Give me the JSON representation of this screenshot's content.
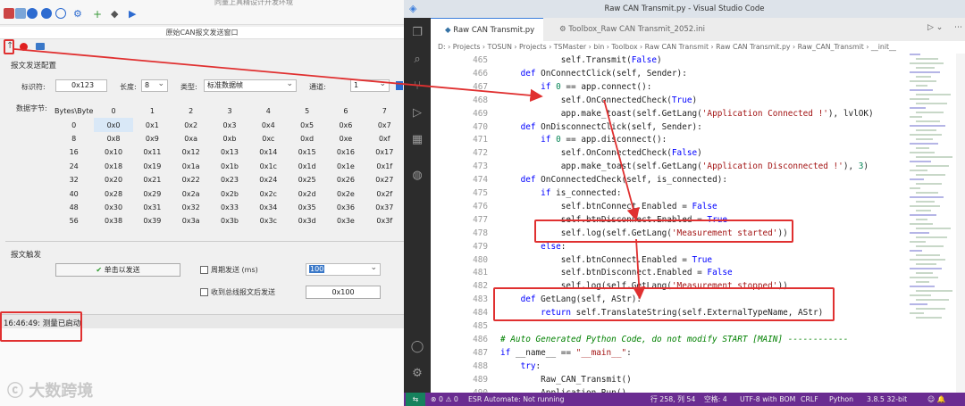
{
  "left_app": {
    "topbar_title_cut": "同量上具精设计开发环境",
    "window_title": "原始CAN报文发送窗口",
    "section_send_config": "报文发送配置",
    "id_label": "标识符:",
    "id_value": "0x123",
    "length_label": "长度:",
    "length_value": "8",
    "type_label": "类型:",
    "type_value": "标准数据帧",
    "channel_label": "通道:",
    "channel_value": "1",
    "data_bytes_label": "数据字节:",
    "grid_header": [
      "Bytes\\Byte",
      "0",
      "1",
      "2",
      "3",
      "4",
      "5",
      "6",
      "7"
    ],
    "grid_rows": [
      [
        "0",
        "0x0",
        "0x1",
        "0x2",
        "0x3",
        "0x4",
        "0x5",
        "0x6",
        "0x7"
      ],
      [
        "8",
        "0x8",
        "0x9",
        "0xa",
        "0xb",
        "0xc",
        "0xd",
        "0xe",
        "0xf"
      ],
      [
        "16",
        "0x10",
        "0x11",
        "0x12",
        "0x13",
        "0x14",
        "0x15",
        "0x16",
        "0x17"
      ],
      [
        "24",
        "0x18",
        "0x19",
        "0x1a",
        "0x1b",
        "0x1c",
        "0x1d",
        "0x1e",
        "0x1f"
      ],
      [
        "32",
        "0x20",
        "0x21",
        "0x22",
        "0x23",
        "0x24",
        "0x25",
        "0x26",
        "0x27"
      ],
      [
        "40",
        "0x28",
        "0x29",
        "0x2a",
        "0x2b",
        "0x2c",
        "0x2d",
        "0x2e",
        "0x2f"
      ],
      [
        "48",
        "0x30",
        "0x31",
        "0x32",
        "0x33",
        "0x34",
        "0x35",
        "0x36",
        "0x37"
      ],
      [
        "56",
        "0x38",
        "0x39",
        "0x3a",
        "0x3b",
        "0x3c",
        "0x3d",
        "0x3e",
        "0x3f"
      ]
    ],
    "section_trigger": "报文触发",
    "send_once_label": "单击以发送",
    "periodic_label": "周期发送 (ms)",
    "period_value": "100",
    "recv_trigger_label": "收到总线报文后发送",
    "recv_id_value": "0x100",
    "status_text": "16:46:49: 测量已启动",
    "watermark": "大数跨境"
  },
  "vscode": {
    "title": "Raw CAN Transmit.py - Visual Studio Code",
    "tabs": [
      {
        "label": "Raw CAN Transmit.py",
        "active": true
      },
      {
        "label": "Toolbox_Raw CAN Transmit_2052.ini",
        "active": false
      }
    ],
    "breadcrumb": "D: › Projects › TOSUN › Projects › TSMaster › bin › Toolbox › Raw CAN Transmit › Raw CAN Transmit.py › Raw_CAN_Transmit › __init__",
    "lines": [
      {
        "n": "465",
        "t": "            self.Transmit(False)"
      },
      {
        "n": "466",
        "t": "    def OnConnectClick(self, Sender):"
      },
      {
        "n": "467",
        "t": "        if 0 == app.connect():"
      },
      {
        "n": "468",
        "t": "            self.OnConnectedCheck(True)"
      },
      {
        "n": "469",
        "t": "            app.make_toast(self.GetLang('Application Connected !'), lvlOK)"
      },
      {
        "n": "470",
        "t": "    def OnDisconnectClick(self, Sender):"
      },
      {
        "n": "471",
        "t": "        if 0 == app.disconnect():"
      },
      {
        "n": "472",
        "t": "            self.OnConnectedCheck(False)"
      },
      {
        "n": "473",
        "t": "            app.make_toast(self.GetLang('Application Disconnected !'), 3)"
      },
      {
        "n": "474",
        "t": "    def OnConnectedCheck(self, is_connected):"
      },
      {
        "n": "475",
        "t": "        if is_connected:"
      },
      {
        "n": "476",
        "t": "            self.btnConnect.Enabled = False"
      },
      {
        "n": "477",
        "t": "            self.btnDisconnect.Enabled = True"
      },
      {
        "n": "478",
        "t": "            self.log(self.GetLang('Measurement started'))"
      },
      {
        "n": "479",
        "t": "        else:"
      },
      {
        "n": "480",
        "t": "            self.btnConnect.Enabled = True"
      },
      {
        "n": "481",
        "t": "            self.btnDisconnect.Enabled = False"
      },
      {
        "n": "482",
        "t": "            self.log(self.GetLang('Measurement stopped'))"
      },
      {
        "n": "483",
        "t": "    def GetLang(self, AStr):"
      },
      {
        "n": "484",
        "t": "        return self.TranslateString(self.ExternalTypeName, AStr)"
      },
      {
        "n": "485",
        "t": ""
      },
      {
        "n": "486",
        "t": "# Auto Generated Python Code, do not modify START [MAIN] ------------"
      },
      {
        "n": "487",
        "t": "if __name__ == \"__main__\":"
      },
      {
        "n": "488",
        "t": "    try:"
      },
      {
        "n": "489",
        "t": "        Raw_CAN_Transmit()"
      },
      {
        "n": "490",
        "t": "        Application.Run()"
      }
    ],
    "status_items": [
      "⊗ 0 ⚠ 0",
      "ESR Automate: Not running",
      "行 258, 列 54",
      "空格: 4",
      "UTF-8 with BOM",
      "CRLF",
      "Python",
      "3.8.5 32-bit"
    ],
    "colors": {
      "keyword": "#0000ff",
      "func": "#795e26",
      "string": "#a31515",
      "comment": "#008000",
      "self": "#001080",
      "number": "#098658",
      "statusbar": "#6a2c91",
      "annotation": "#e03030"
    }
  }
}
